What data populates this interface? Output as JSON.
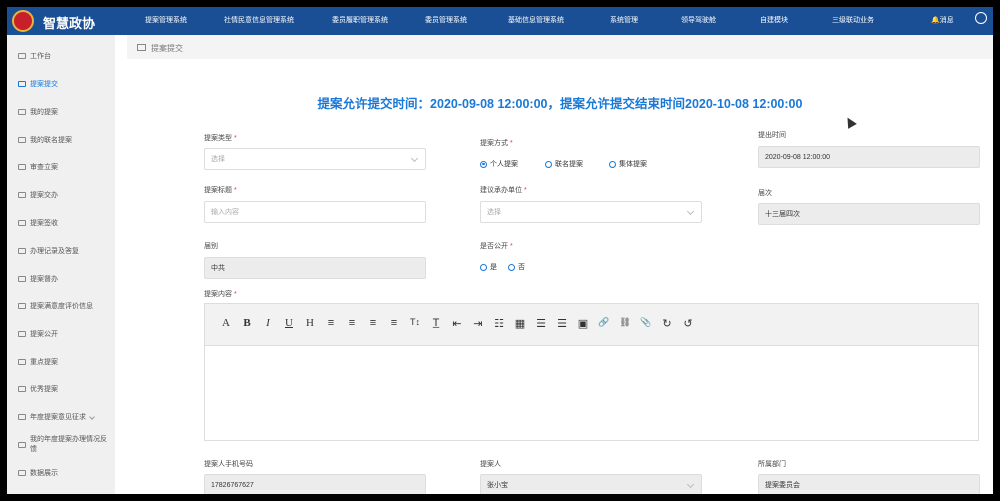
{
  "header": {
    "brand": "智慧政协",
    "nav": [
      "提案管理系统",
      "社情民意信息管理系统",
      "委员履职管理系统",
      "委员管理系统",
      "基础信息管理系统",
      "系统管理",
      "领导驾驶舱",
      "自建模块",
      "三级联动业务"
    ],
    "message": "消息"
  },
  "sidebar": {
    "items": [
      {
        "label": "工作台",
        "active": false
      },
      {
        "label": "提案提交",
        "active": true
      },
      {
        "label": "我的提案",
        "active": false
      },
      {
        "label": "我的联名提案",
        "active": false
      },
      {
        "label": "审查立案",
        "active": false
      },
      {
        "label": "提案交办",
        "active": false
      },
      {
        "label": "提案签收",
        "active": false
      },
      {
        "label": "办理记录及答复",
        "active": false
      },
      {
        "label": "提案督办",
        "active": false
      },
      {
        "label": "提案满意度评价信息",
        "active": false
      },
      {
        "label": "提案公开",
        "active": false
      },
      {
        "label": "重点提案",
        "active": false
      },
      {
        "label": "优秀提案",
        "active": false
      },
      {
        "label": "年度提案意见征求",
        "active": false
      },
      {
        "label": "我的年度提案办理情况反馈",
        "active": false
      },
      {
        "label": "数据展示",
        "active": false
      }
    ]
  },
  "breadcrumb": "提案提交",
  "headline": "提案允许提交时间：2020-09-08 12:00:00，提案允许提交结束时间2020-10-08 12:00:00",
  "form": {
    "type_label": "提案类型",
    "type_placeholder": "选择",
    "mode_label": "提案方式",
    "mode_options": [
      "个人提案",
      "联名提案",
      "集体提案"
    ],
    "mode_selected": 0,
    "time_label": "提出时间",
    "time_value": "2020-09-08 12:00:00",
    "title_label": "提案标题",
    "title_placeholder": "输入内容",
    "unit_label": "建议承办单位",
    "unit_placeholder": "选择",
    "session_label": "届次",
    "session_value": "十三届四次",
    "party_label": "届别",
    "party_value": "中共",
    "public_label": "是否公开",
    "public_options": [
      "是",
      "否"
    ],
    "content_label": "提案内容",
    "phone_label": "提案人手机号码",
    "phone_value": "17826767627",
    "proposer_label": "提案人",
    "proposer_value": "张小宝",
    "dept_label": "所属部门",
    "dept_value": "提案委员会"
  },
  "toolbar": [
    "A",
    "B",
    "I",
    "U",
    "H",
    "≡",
    "≡",
    "≡",
    "≡",
    "T↕",
    "T̲",
    "⇤",
    "⇥",
    "☷",
    "▦",
    "☰",
    "☰",
    "▣",
    "🔗",
    "⛓",
    "📎",
    "↻",
    "↺"
  ]
}
